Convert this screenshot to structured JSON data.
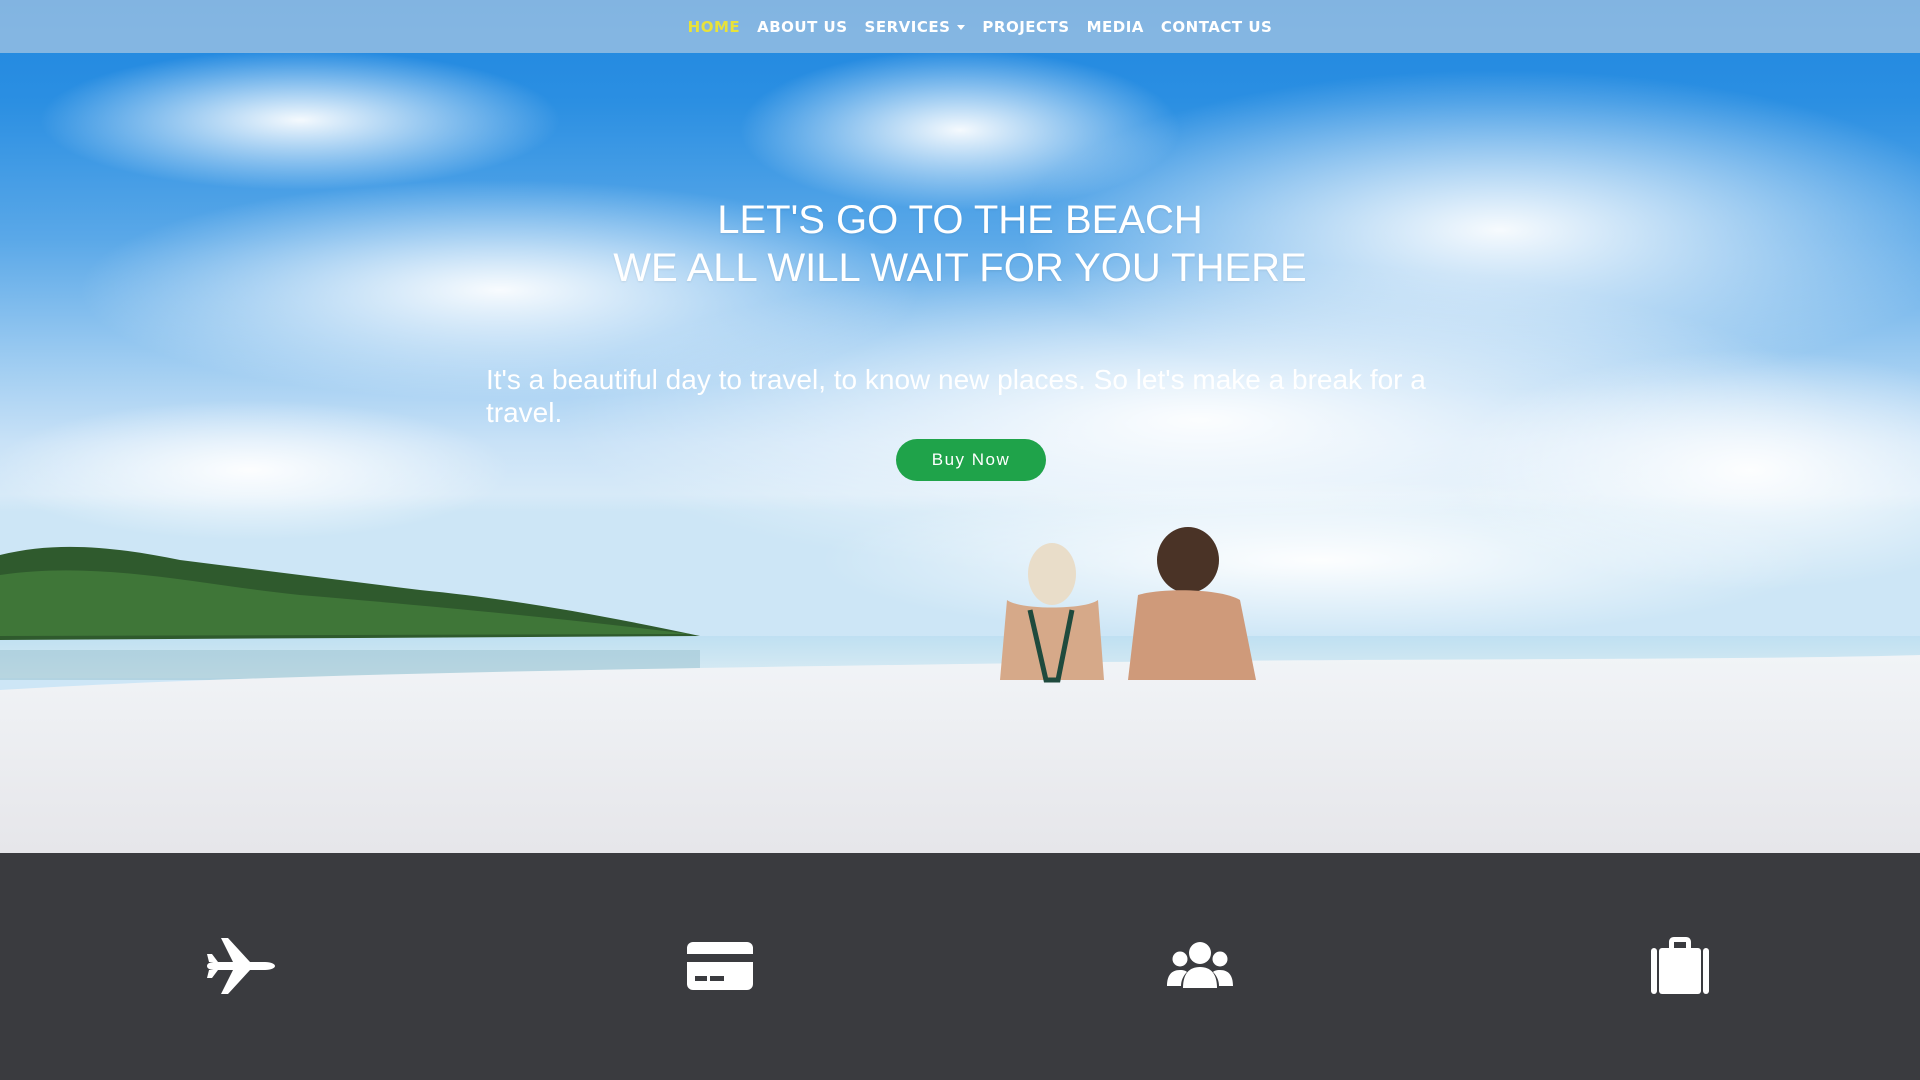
{
  "nav": {
    "items": [
      {
        "label": "HOME",
        "active": true
      },
      {
        "label": "ABOUT US"
      },
      {
        "label": "SERVICES",
        "has_dropdown": true
      },
      {
        "label": "PROJECTS"
      },
      {
        "label": "MEDIA"
      },
      {
        "label": "CONTACT US"
      }
    ]
  },
  "hero": {
    "title_line1": "LET'S GO TO THE BEACH",
    "title_line2": "WE ALL WILL WAIT FOR YOU THERE",
    "text": "It's a beautiful day to travel, to know new places. So let's make a break for a travel.",
    "button_label": "Buy Now"
  },
  "features": {
    "icons": [
      "plane-icon",
      "credit-card-icon",
      "users-icon",
      "suitcase-icon"
    ]
  },
  "colors": {
    "active_nav": "#e8e23a",
    "button": "#1fa34a",
    "features_bg": "#3a3b3f"
  }
}
